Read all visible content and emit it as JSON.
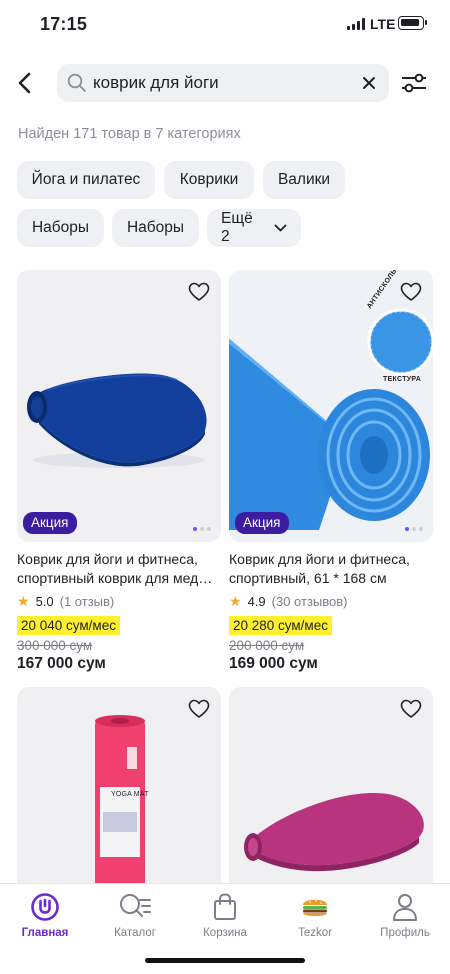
{
  "status": {
    "time": "17:15",
    "network": "LTE"
  },
  "search": {
    "value": "коврик для йоги",
    "placeholder": ""
  },
  "results_text": "Найден 171 товар в 7 категориях",
  "chips": [
    "Йога и пилатес",
    "Коврики",
    "Валики",
    "Наборы",
    "Наборы",
    "Ещё 2"
  ],
  "products": [
    {
      "title_line1": "Коврик для йоги и фитнеса,",
      "title_line2": "спортивный коврик для медита…",
      "rating": "5.0",
      "reviews": "(1 отзыв)",
      "installment": "20 040 сум/мес",
      "old_price": "300 000 сум",
      "price": "167 000 сум",
      "badge": "Акция",
      "image_color": "#0f3f98"
    },
    {
      "title_line1": "Коврик для йоги и фитнеса,",
      "title_line2": "спортивный, 61 * 168 см",
      "rating": "4.9",
      "reviews": "(30 отзывов)",
      "installment": "20 280 сум/мес",
      "old_price": "200 000 сум",
      "price": "169 000 сум",
      "badge": "Акция",
      "image_label_top": "АНТИСКОЛЬЗЯЩАЯ",
      "image_label_bottom": "ТЕКСТУРА",
      "image_color": "#3d97e8"
    },
    {
      "image_label": "YOGA MAT",
      "image_color": "#f0406e"
    },
    {
      "image_color": "#b9347f"
    }
  ],
  "tabs": [
    "Главная",
    "Каталог",
    "Корзина",
    "Tezkor",
    "Профиль"
  ],
  "colors": {
    "accent": "#6a2ad8",
    "badge": "#3c1d9f",
    "installment_bg": "#fff02d"
  }
}
